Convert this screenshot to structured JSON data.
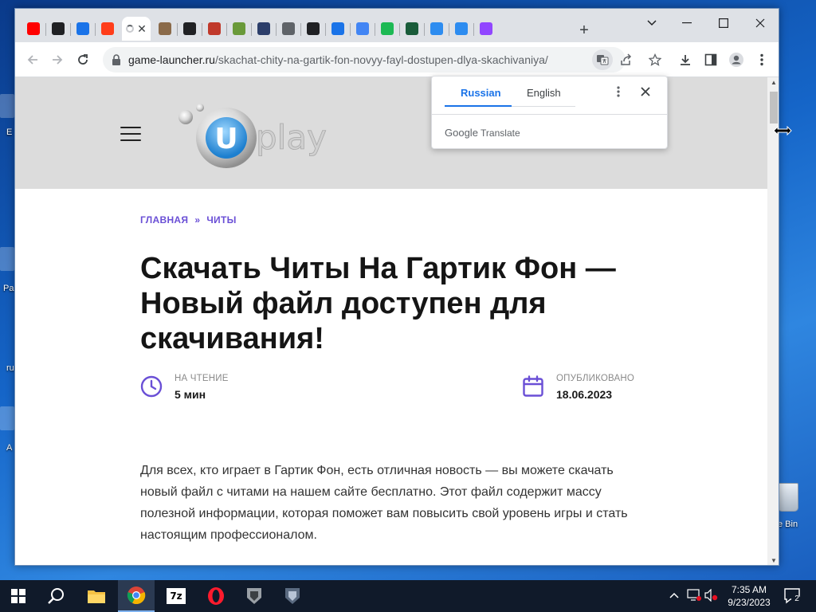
{
  "desktop": {
    "labels": [
      "E",
      "Pa",
      "ru",
      "A"
    ],
    "recycle_bin_label": "e Bin"
  },
  "browser": {
    "tabs": [
      {
        "icon": "youtube-icon",
        "color": "#ff0000"
      },
      {
        "icon": "bolt-icon",
        "color": "#202124"
      },
      {
        "icon": "sigma-icon",
        "color": "#1a73e8"
      },
      {
        "icon": "yandex-icon",
        "color": "#ff3d1a"
      },
      {
        "icon": "loading-icon",
        "color": "#5f6368",
        "active": true
      },
      {
        "icon": "figure-icon",
        "color": "#8a6a4a"
      },
      {
        "icon": "github-icon",
        "color": "#202124"
      },
      {
        "icon": "badge-icon",
        "color": "#c0392b"
      },
      {
        "icon": "frog-icon",
        "color": "#6a9a3a"
      },
      {
        "icon": "tools-icon",
        "color": "#2c3e6a"
      },
      {
        "icon": "globe-icon",
        "color": "#5f6368"
      },
      {
        "icon": "github-icon",
        "color": "#202124"
      },
      {
        "icon": "chevrons-icon",
        "color": "#1a73e8"
      },
      {
        "icon": "google-icon",
        "color": "#4285f4"
      },
      {
        "icon": "shield-icon",
        "color": "#1db954"
      },
      {
        "icon": "terminal-icon",
        "color": "#1a5c3a"
      },
      {
        "icon": "swirl-icon",
        "color": "#2d8cf0"
      },
      {
        "icon": "swirl-icon",
        "color": "#2d8cf0"
      },
      {
        "icon": "twitch-icon",
        "color": "#9146ff"
      }
    ],
    "active_tab_close": "✕",
    "new_tab": "+",
    "url_host": "game-launcher.ru",
    "url_path": "/skachat-chity-na-gartik-fon-novyy-fayl-dostupen-dlya-skachivaniya/"
  },
  "site": {
    "logo_text": "play",
    "logo_letter": "U"
  },
  "breadcrumb": {
    "home": "ГЛАВНАЯ",
    "separator": "»",
    "section": "ЧИТЫ"
  },
  "article": {
    "title": "Скачать Читы На Гартик Фон — Новый файл доступен для скачивания!",
    "reading_label": "НА ЧТЕНИЕ",
    "reading_value": "5 мин",
    "published_label": "ОПУБЛИКОВАНО",
    "published_value": "18.06.2023",
    "body": "Для всех, кто играет в Гартик Фон, есть отличная новость — вы можете скачать новый файл с читами на нашем сайте бесплатно. Этот файл содержит массу полезной информации, которая поможет вам повысить свой уровень игры и стать настоящим профессионалом."
  },
  "translate_popup": {
    "tab_source": "Russian",
    "tab_target": "English",
    "brand_google": "Google",
    "brand_translate": "Translate"
  },
  "taskbar": {
    "clock_time": "7:35 AM",
    "clock_date": "9/23/2023",
    "notification_count": "2",
    "apps": [
      "file-explorer-icon",
      "chrome-icon",
      "7zip-icon",
      "opera-icon",
      "world-of-tanks-icon",
      "world-of-warships-icon"
    ],
    "app_7zip_label": "7z"
  },
  "colors": {
    "accent": "#6a4fd6",
    "google_blue": "#1a73e8",
    "taskbar": "#101a2a"
  }
}
